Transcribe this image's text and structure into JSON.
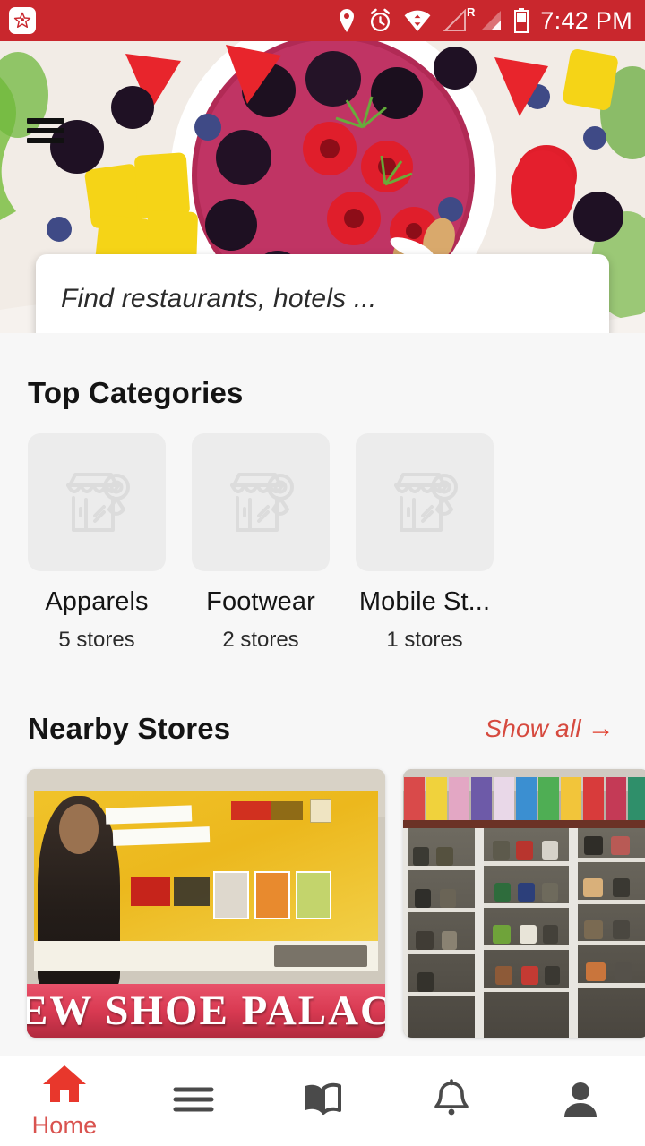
{
  "status_bar": {
    "app_icon": "star-badge-icon",
    "icons": [
      "location-pin-icon",
      "alarm-clock-icon",
      "wifi-transfer-icon",
      "signal-roaming-icon",
      "signal-bars-icon",
      "battery-icon"
    ],
    "roaming_label": "R",
    "time": "7:42 PM",
    "background_color": "#c9272d"
  },
  "hero": {
    "menu_icon": "hamburger-menu-icon",
    "image_alt": "fruit bowl with berries and mango"
  },
  "search": {
    "placeholder": "Find restaurants, hotels ...",
    "value": ""
  },
  "top_categories": {
    "title": "Top Categories",
    "items": [
      {
        "name": "Apparels",
        "count_label": "5 stores",
        "thumb": "store-placeholder-icon"
      },
      {
        "name": "Footwear",
        "count_label": "2 stores",
        "thumb": "store-placeholder-icon"
      },
      {
        "name": "Mobile St...",
        "count_label": "1 stores",
        "thumb": "store-placeholder-icon"
      }
    ]
  },
  "nearby_stores": {
    "title": "Nearby Stores",
    "show_all_label": "Show all",
    "show_all_arrow": "→",
    "accent_color": "#d64a3f",
    "cards": [
      {
        "sign_text": "EW SHOE PALAC",
        "alt": "shoe shop storefront with yellow VKC pride banner"
      },
      {
        "alt": "shoe store interior with glass display shelves"
      }
    ]
  },
  "bottom_nav": {
    "active_color": "#d9534f",
    "inactive_color": "#4a4a4a",
    "items": [
      {
        "icon": "home-icon",
        "label": "Home",
        "active": true
      },
      {
        "icon": "menu-list-icon",
        "label": "",
        "active": false
      },
      {
        "icon": "book-icon",
        "label": "",
        "active": false
      },
      {
        "icon": "bell-icon",
        "label": "",
        "active": false
      },
      {
        "icon": "person-icon",
        "label": "",
        "active": false
      }
    ]
  }
}
